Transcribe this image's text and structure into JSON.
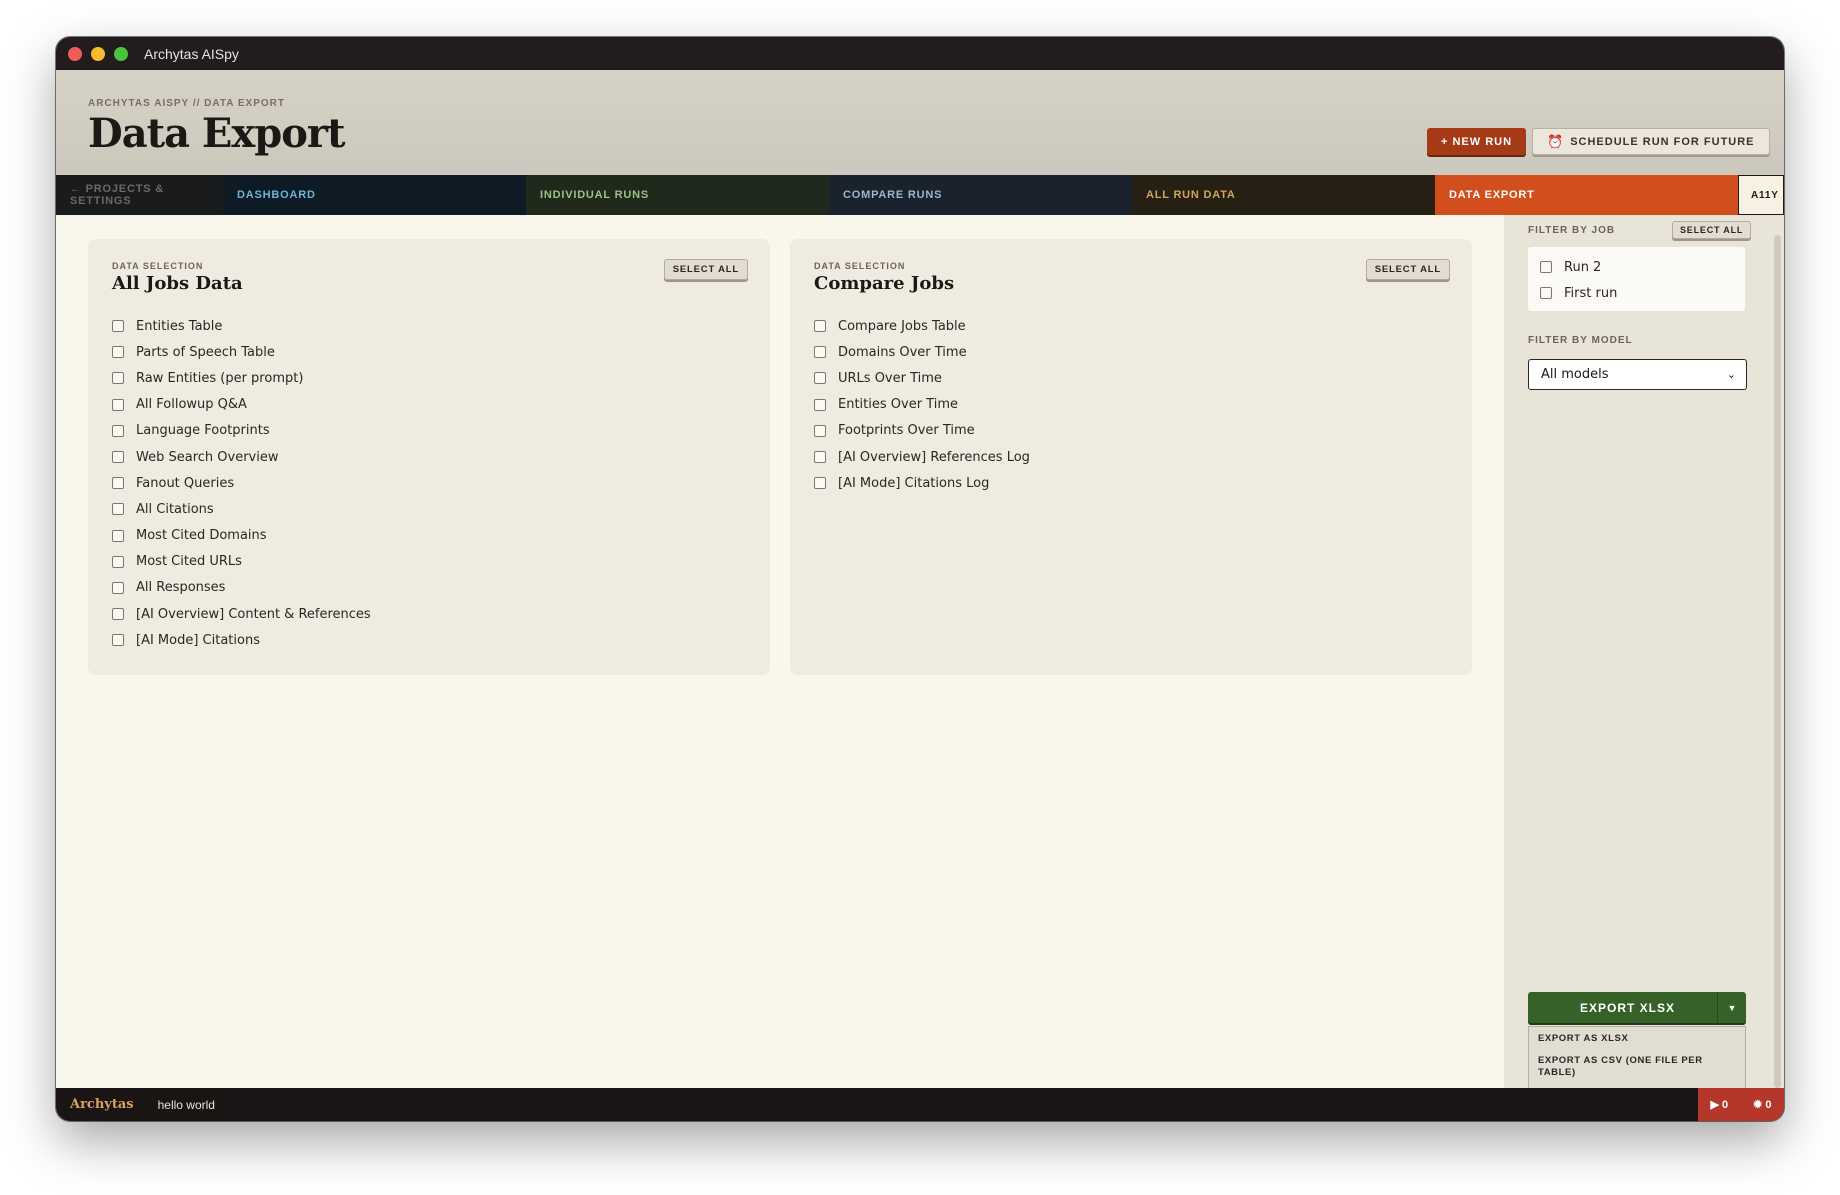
{
  "window": {
    "app_title": "Archytas AISpy"
  },
  "header": {
    "breadcrumb": "ARCHYTAS AISPY // DATA EXPORT",
    "title": "Data Export",
    "new_run_label": "+ NEW RUN",
    "schedule_label": "SCHEDULE RUN FOR FUTURE"
  },
  "nav": {
    "projects": "← PROJECTS & SETTINGS",
    "dashboard": "DASHBOARD",
    "individual_runs": "INDIVIDUAL RUNS",
    "compare_runs": "COMPARE RUNS",
    "all_run_data": "ALL RUN DATA",
    "data_export": "DATA EXPORT",
    "a11y": "A11Y"
  },
  "panels": {
    "all_jobs": {
      "kicker": "DATA SELECTION",
      "title": "All Jobs Data",
      "select_all": "SELECT ALL",
      "items": [
        "Entities Table",
        "Parts of Speech Table",
        "Raw Entities (per prompt)",
        "All Followup Q&A",
        "Language Footprints",
        "Web Search Overview",
        "Fanout Queries",
        "All Citations",
        "Most Cited Domains",
        "Most Cited URLs",
        "All Responses",
        "[AI Overview] Content & References",
        "[AI Mode] Citations"
      ]
    },
    "compare_jobs": {
      "kicker": "DATA SELECTION",
      "title": "Compare Jobs",
      "select_all": "SELECT ALL",
      "items": [
        "Compare Jobs Table",
        "Domains Over Time",
        "URLs Over Time",
        "Entities Over Time",
        "Footprints Over Time",
        "[AI Overview] References Log",
        "[AI Mode] Citations Log"
      ]
    }
  },
  "sidebar": {
    "filter_job_label": "FILTER BY JOB",
    "select_all": "SELECT ALL",
    "jobs": [
      "Run 2",
      "First run"
    ],
    "filter_model_label": "FILTER BY MODEL",
    "model_selected": "All models",
    "export_label": "EXPORT XLSX",
    "export_menu": [
      "EXPORT AS XLSX",
      "EXPORT AS CSV (ONE FILE PER TABLE)"
    ]
  },
  "status": {
    "brand": "Archytas",
    "message": "hello world",
    "runs_count": "▶ 0",
    "errors_count": "0"
  },
  "colors": {
    "accent": "#d24f1d",
    "export_green": "#36622a",
    "status_red": "#b5362a"
  }
}
